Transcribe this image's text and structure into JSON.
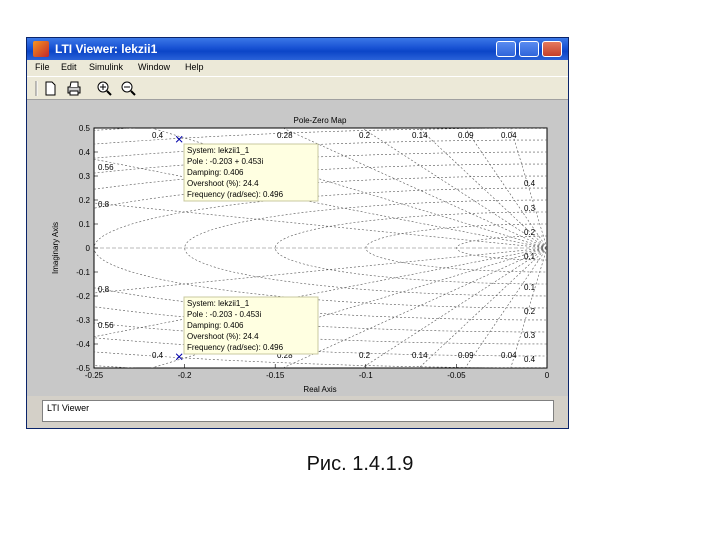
{
  "window": {
    "title": "LTI Viewer: lekzii1"
  },
  "menu": {
    "items": [
      "File",
      "Edit",
      "Simulink",
      "Window",
      "Help"
    ]
  },
  "toolbar": {
    "tools": [
      "new-icon",
      "print-icon",
      "zoom-in-icon",
      "zoom-out-icon"
    ]
  },
  "plot": {
    "title": "Pole-Zero Map",
    "xlabel": "Real Axis",
    "ylabel": "Imaginary Axis",
    "x_ticks": [
      "-0.25",
      "-0.2",
      "-0.15",
      "-0.1",
      "-0.05",
      "0"
    ],
    "y_ticks": [
      "0.5",
      "0.4",
      "0.3",
      "0.2",
      "0.1",
      "0",
      "-0.1",
      "-0.2",
      "-0.3",
      "-0.4",
      "-0.5"
    ],
    "damping_labels_top": [
      "0.4",
      "0.28",
      "0.2",
      "0.14",
      "0.09",
      "0.04"
    ],
    "damping_labels_bottom": [
      "0.4",
      "0.28",
      "0.2",
      "0.14",
      "0.09",
      "0.04"
    ],
    "damping_labels_left": [
      "0.56",
      "0.8",
      "0.8",
      "0.56"
    ],
    "freq_labels_right_top": [
      "0.4",
      "0.3",
      "0.2",
      "0.1"
    ],
    "freq_labels_right_bottom": [
      "0.1",
      "0.2",
      "0.3",
      "0.4"
    ],
    "datatip_top": {
      "system": "System: lekzii1_1",
      "pole": "Pole : -0.203 + 0.453i",
      "damping": "Damping: 0.406",
      "overshoot": "Overshoot (%): 24.4",
      "frequency": "Frequency (rad/sec): 0.496"
    },
    "datatip_bottom": {
      "system": "System: lekzii1_1",
      "pole": "Pole : -0.203 - 0.453i",
      "damping": "Damping: 0.406",
      "overshoot": "Overshoot (%): 24.4",
      "frequency": "Frequency (rad/sec): 0.496"
    }
  },
  "chart_data": {
    "type": "scatter",
    "title": "Pole-Zero Map",
    "xlabel": "Real Axis",
    "ylabel": "Imaginary Axis",
    "xlim": [
      -0.25,
      0
    ],
    "ylim": [
      -0.5,
      0.5
    ],
    "grid": true,
    "series": [
      {
        "marker": "x",
        "x": [
          -0.203,
          -0.203
        ],
        "y": [
          0.453,
          -0.453
        ]
      }
    ]
  },
  "status": {
    "text": "LTI Viewer"
  },
  "caption": {
    "text": "Рис. 1.4.1.9"
  }
}
